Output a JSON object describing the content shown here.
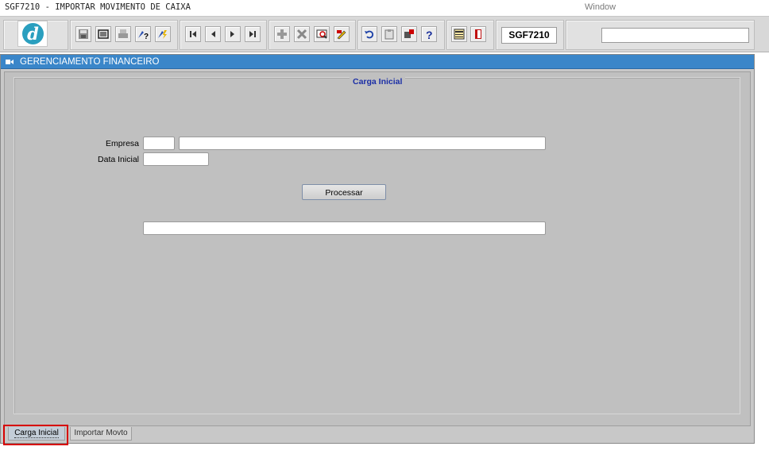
{
  "window": {
    "title": "SGF7210 - IMPORTAR MOVIMENTO DE CAIXA",
    "menu_label": "Window"
  },
  "toolbar": {
    "logo_icon": "app-logo-d-icon",
    "form_code": "SGF7210",
    "search_value": "",
    "buttons": [
      {
        "name": "save-icon"
      },
      {
        "name": "window-icon"
      },
      {
        "name": "print-icon"
      },
      {
        "name": "query-help-icon"
      },
      {
        "name": "execute-query-icon"
      },
      {
        "name": "first-record-icon"
      },
      {
        "name": "previous-record-icon"
      },
      {
        "name": "next-record-icon"
      },
      {
        "name": "last-record-icon"
      },
      {
        "name": "insert-record-icon"
      },
      {
        "name": "delete-record-icon"
      },
      {
        "name": "lov-icon"
      },
      {
        "name": "edit-icon"
      },
      {
        "name": "undo-icon"
      },
      {
        "name": "clipboard-icon"
      },
      {
        "name": "tools-icon"
      },
      {
        "name": "help-icon"
      },
      {
        "name": "menu-icon"
      },
      {
        "name": "exit-icon"
      }
    ]
  },
  "panel": {
    "title": "GERENCIAMENTO FINANCEIRO"
  },
  "form": {
    "section_title": "Carga Inicial",
    "empresa_label": "Empresa",
    "empresa_code": "",
    "empresa_name": "",
    "data_inicial_label": "Data Inicial",
    "data_inicial_value": "",
    "process_button": "Processar",
    "status_value": ""
  },
  "tabs": [
    {
      "label": "Carga Inicial",
      "active": true
    },
    {
      "label": "Importar Movto",
      "active": false
    }
  ],
  "colors": {
    "title_blue": "#3a86c9",
    "section_title": "#1c2fa6",
    "highlight": "#d60000"
  }
}
